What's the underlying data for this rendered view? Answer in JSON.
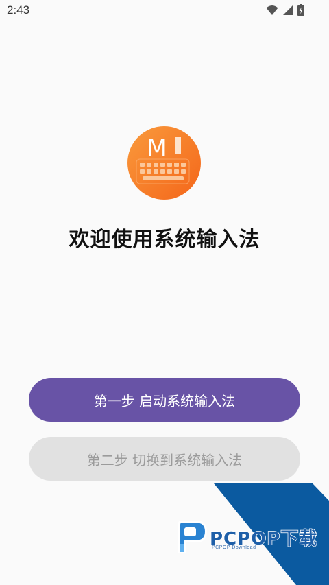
{
  "status_bar": {
    "time": "2:43",
    "icons": [
      "wifi-icon",
      "signal-icon",
      "battery-icon"
    ]
  },
  "app": {
    "logo_letter": "M",
    "welcome_title": "欢迎使用系统输入法",
    "step1_label": "第一步 启动系统输入法",
    "step2_label": "第二步 切换到系统输入法"
  },
  "watermark": {
    "brand": "PCPOP下载",
    "subtext": "PCPOP Download"
  },
  "colors": {
    "primary_button": "#6853a6",
    "disabled_button": "#e1e1e1",
    "logo_orange": "#f6771e",
    "watermark_blue": "#0b5aa0"
  }
}
